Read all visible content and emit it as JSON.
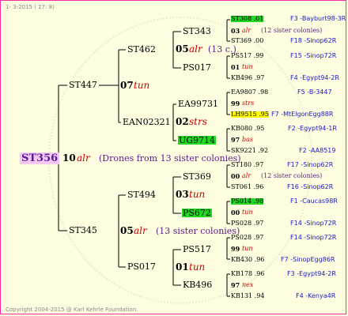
{
  "header": {
    "date_label": "1- 3-2015 ( 17: 8)"
  },
  "footer": {
    "copyright": "Copyright 2004-2015 @ Karl Kehrle Foundation."
  },
  "tree": {
    "root": {
      "name": "ST356",
      "num": "10",
      "race": "alr",
      "note": "(Drones from 13 sister colonies)"
    },
    "queen_A": {
      "name": "ST447",
      "num": "07",
      "race": "tun"
    },
    "queen_AA": {
      "name": "ST462",
      "num": "05",
      "race": "alr",
      "note": "(13 c.)"
    },
    "queen_AAA": {
      "name": "ST343"
    },
    "queen_AAB": {
      "name": "PS017"
    },
    "queen_AB": {
      "name": "EAN02321",
      "num": "02",
      "race": "strs"
    },
    "queen_ABA": {
      "name": "EA99731"
    },
    "queen_ABB": {
      "name": "UG9714"
    },
    "queen_B": {
      "name": "ST345",
      "num": "05",
      "race": "alr",
      "note": "(13 sister colonies)"
    },
    "queen_BA": {
      "name": "ST494",
      "num": "03",
      "race": "tun"
    },
    "queen_BAA": {
      "name": "ST369"
    },
    "queen_BAB": {
      "name": "PS672"
    },
    "queen_BB": {
      "name": "PS017",
      "num": "01",
      "race": "tun"
    },
    "queen_BBA": {
      "name": "PS517"
    },
    "queen_BBB": {
      "name": "KB496"
    }
  },
  "leaves": [
    {
      "a": "ST308 .01",
      "b": "F3 -Bayburt98-3R"
    },
    {
      "a": "03",
      "r": "alr",
      "c": "(12 sister colonies)"
    },
    {
      "a": "ST369 .00",
      "b": "F18 -Sinop62R"
    },
    {
      "a": "PS517 .99",
      "b": "F15 -Sinop72R"
    },
    {
      "a": "01",
      "r": "tun"
    },
    {
      "a": "KB496 .97",
      "b": "F4 -Egypt94-2R"
    },
    {
      "a": "EA9807 .98",
      "b": "F5 -B-3447"
    },
    {
      "a": "99",
      "r": "strs"
    },
    {
      "a": "LH9515 .95",
      "b": "F7 -MtElgonEgg88R"
    },
    {
      "a": "KB080 .95",
      "b": "F2 -Egypt94-1R"
    },
    {
      "a": "97",
      "r": "bas"
    },
    {
      "a": "SK9221 .92",
      "b": "F2 -AA8519"
    },
    {
      "a": "ST180 .97",
      "b": "F17 -Sinop62R"
    },
    {
      "a": "00",
      "r": "alr",
      "c": "(12 sister colonies)"
    },
    {
      "a": "ST061 .96",
      "b": "F16 -Sinop62R"
    },
    {
      "a": "PS014 .98",
      "b": "F1 -Caucas98R"
    },
    {
      "a": "00",
      "r": "tun"
    },
    {
      "a": "PS028 .97",
      "b": "F14 -Sinop72R"
    },
    {
      "a": "PS028 .97",
      "b": "F14 -Sinop72R"
    },
    {
      "a": "99",
      "r": "tun"
    },
    {
      "a": "KB430 .96",
      "b": "F7 -SinopEgg86R"
    },
    {
      "a": "KB178 .96",
      "b": "F3 -Egypt94-2R"
    },
    {
      "a": "97",
      "r": "nex"
    },
    {
      "a": "KB131 .94",
      "b": "F4 -Kenya4R"
    }
  ]
}
